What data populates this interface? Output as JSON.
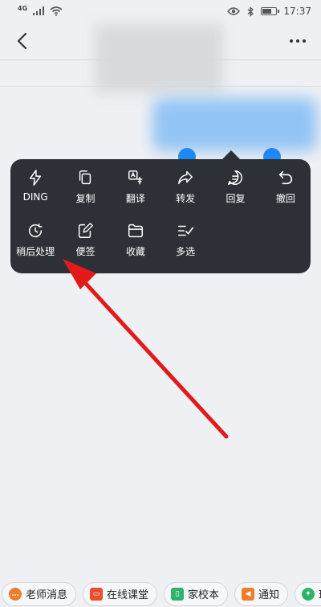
{
  "status_bar": {
    "network": "4G",
    "time": "17:37"
  },
  "menu": {
    "items": [
      {
        "label": "DING",
        "icon": "lightning-icon"
      },
      {
        "label": "复制",
        "icon": "copy-icon"
      },
      {
        "label": "翻译",
        "icon": "translate-icon"
      },
      {
        "label": "转发",
        "icon": "forward-icon"
      },
      {
        "label": "回复",
        "icon": "reply-icon"
      },
      {
        "label": "撤回",
        "icon": "undo-icon"
      },
      {
        "label": "稍后处理",
        "icon": "clock-icon"
      },
      {
        "label": "便签",
        "icon": "note-icon"
      },
      {
        "label": "收藏",
        "icon": "folder-icon"
      },
      {
        "label": "多选",
        "icon": "multiselect-icon"
      }
    ]
  },
  "bottom_tags": [
    {
      "label": "老师消息",
      "icon": "chat-icon",
      "color": "#f07d2d"
    },
    {
      "label": "在线课堂",
      "icon": "classroom-icon",
      "color": "#e8502e"
    },
    {
      "label": "家校本",
      "icon": "book-icon",
      "color": "#2fb36b"
    },
    {
      "label": "通知",
      "icon": "megaphone-icon",
      "color": "#f07d2d"
    },
    {
      "label": "班",
      "icon": "class-icon",
      "color": "#2fb36b"
    }
  ],
  "colors": {
    "menu_bg": "#2d3036",
    "selection_handle": "#1e88f5",
    "annotation_arrow": "#e21a1a"
  }
}
